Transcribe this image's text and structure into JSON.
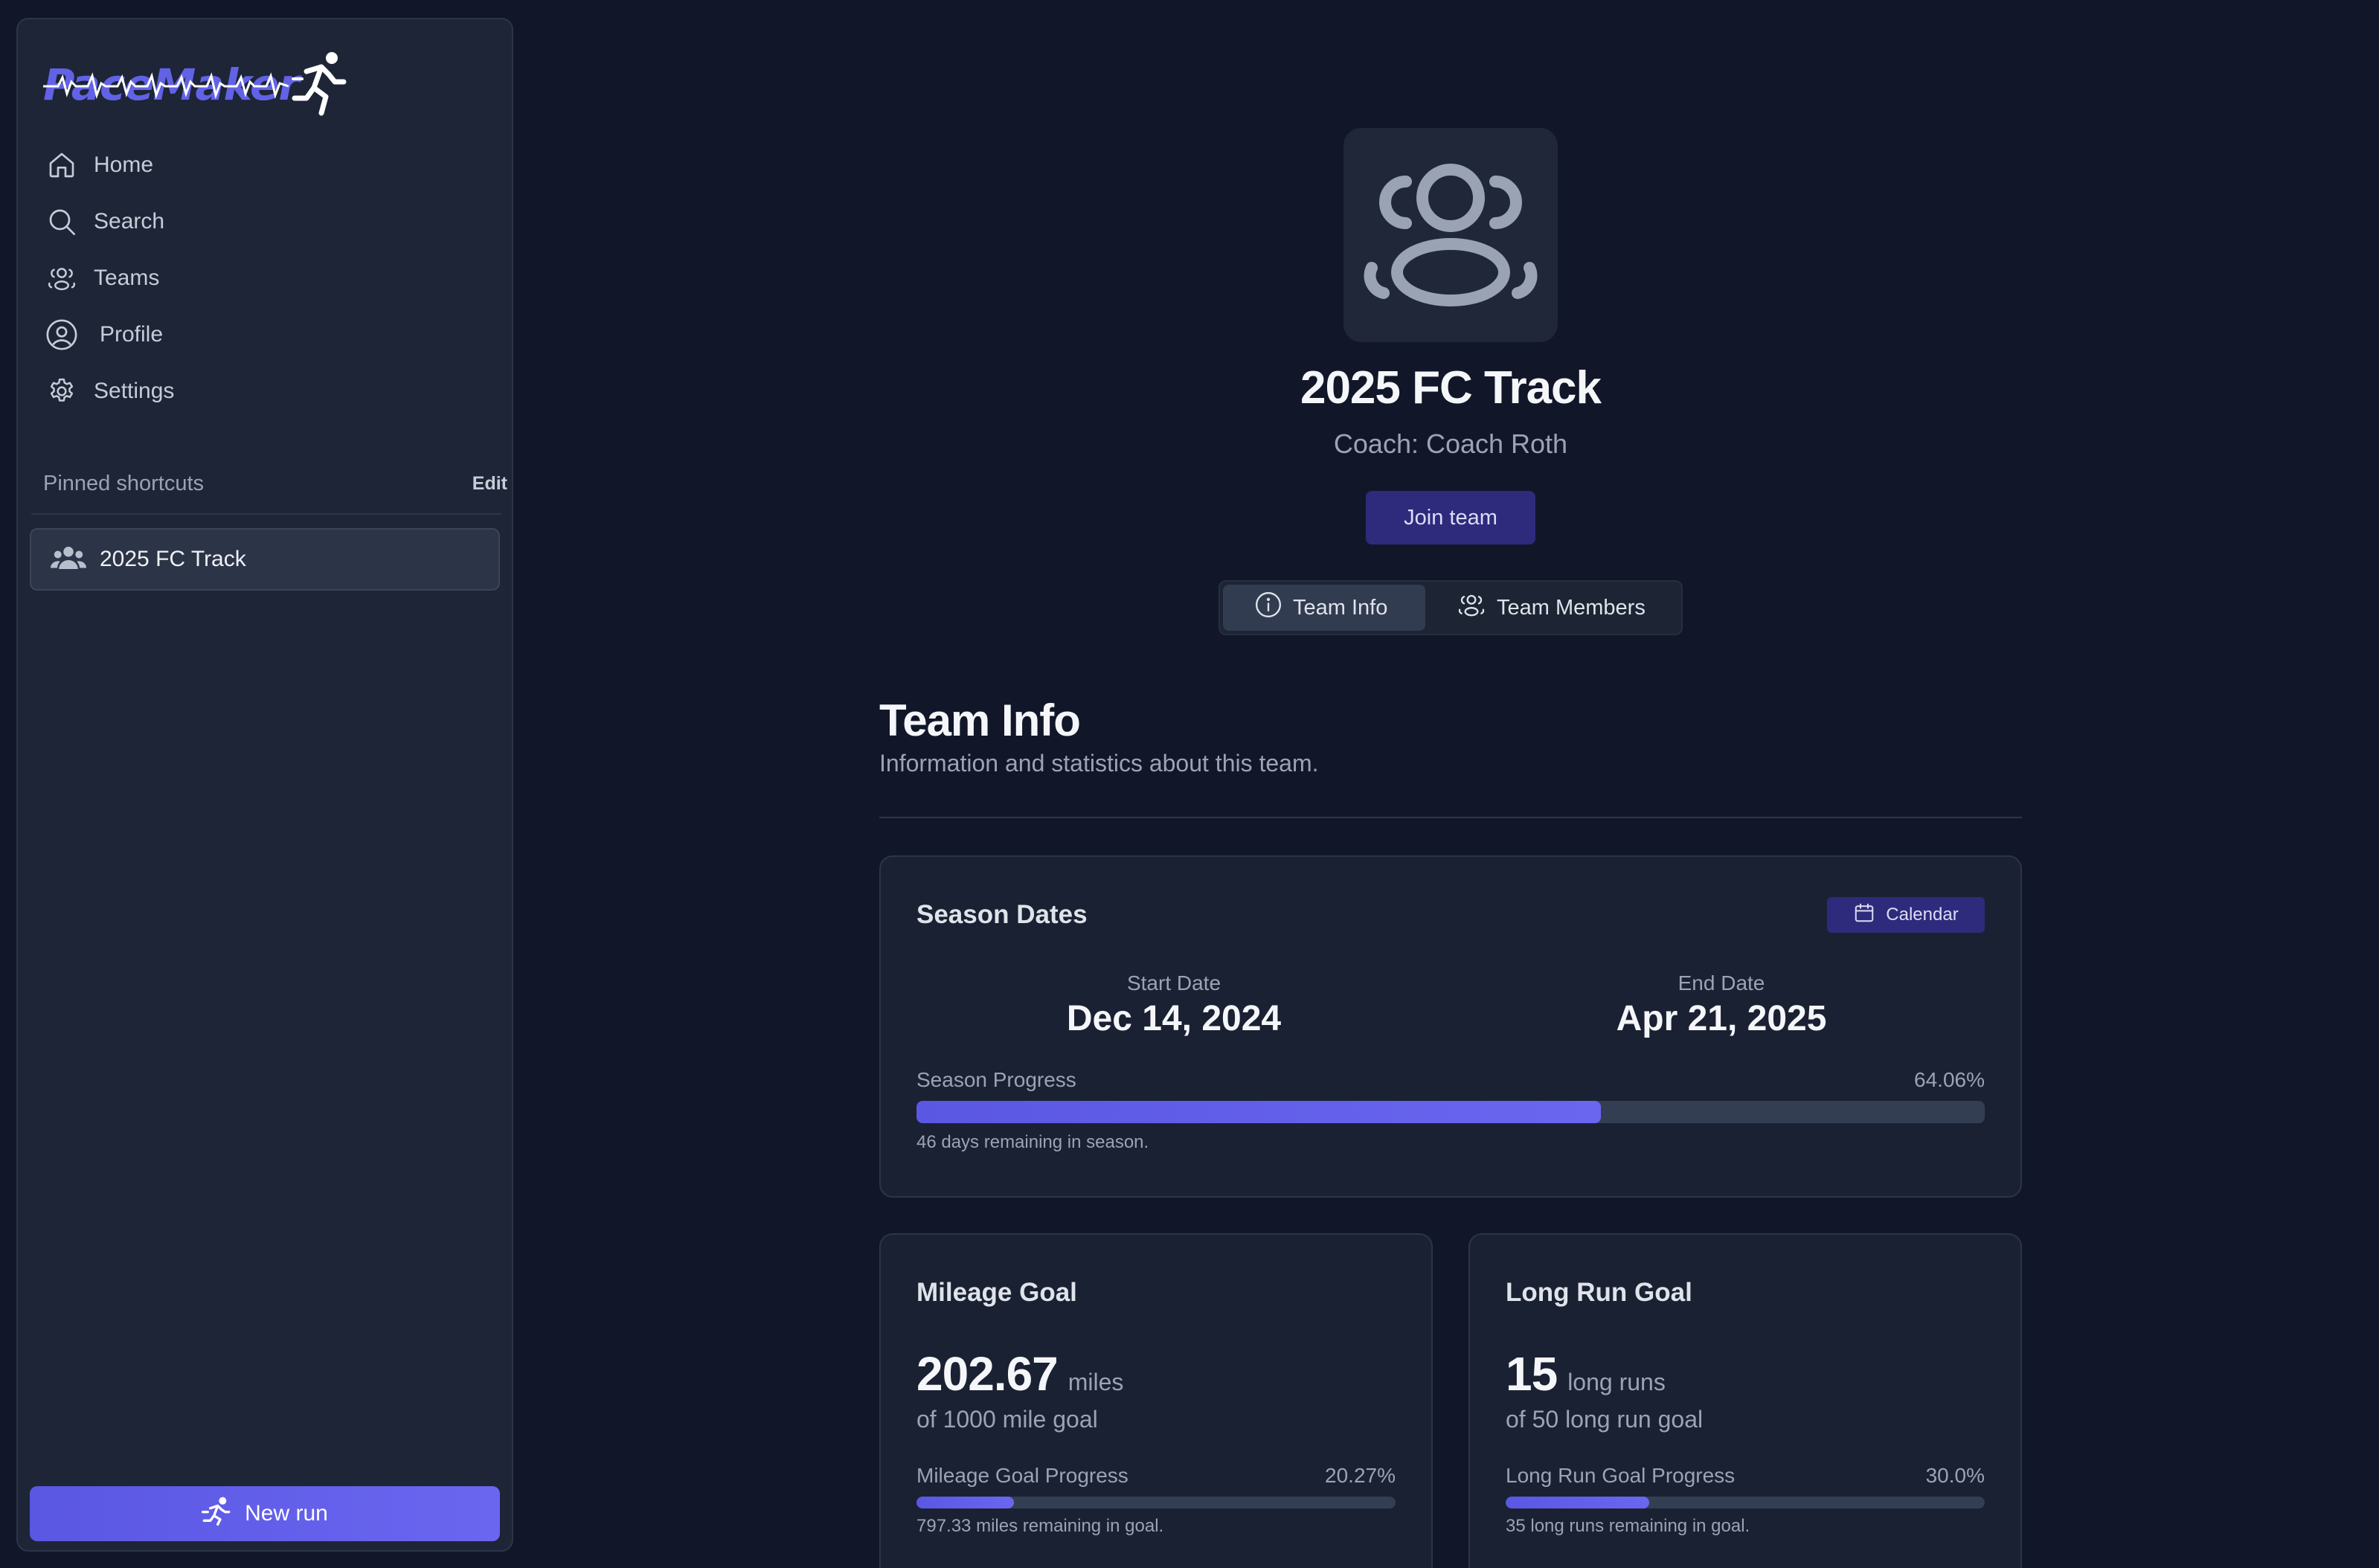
{
  "app": {
    "name": "PaceMaker",
    "accent": "#6262e6"
  },
  "sidebar": {
    "items": [
      {
        "label": "Home",
        "icon": "home-icon"
      },
      {
        "label": "Search",
        "icon": "search-icon"
      },
      {
        "label": "Teams",
        "icon": "users-icon"
      },
      {
        "label": "Profile",
        "icon": "user-circle-icon"
      },
      {
        "label": "Settings",
        "icon": "gear-icon"
      }
    ],
    "pinned_title": "Pinned shortcuts",
    "pinned_edit": "Edit",
    "pinned": [
      {
        "label": "2025 FC Track",
        "icon": "team-icon"
      }
    ],
    "new_run": "New run"
  },
  "team": {
    "name": "2025 FC Track",
    "coach": "Coach: Coach Roth",
    "join": "Join team",
    "tabs": [
      {
        "label": "Team Info",
        "active": true
      },
      {
        "label": "Team Members",
        "active": false
      }
    ]
  },
  "section": {
    "title": "Team Info",
    "subtitle": "Information and statistics about this team."
  },
  "season": {
    "title": "Season Dates",
    "calendar": "Calendar",
    "start_label": "Start Date",
    "start": "Dec 14, 2024",
    "end_label": "End Date",
    "end": "Apr 21, 2025",
    "progress_label": "Season Progress",
    "progress_text": "64.06%",
    "progress": 0.6406,
    "note": "46 days remaining in season."
  },
  "mileage": {
    "title": "Mileage Goal",
    "value": "202.67",
    "unit": "miles",
    "of": "of 1000 mile goal",
    "progress_label": "Mileage Goal Progress",
    "progress_text": "20.27%",
    "progress": 0.2027,
    "note": "797.33 miles remaining in goal."
  },
  "longrun": {
    "title": "Long Run Goal",
    "value": "15",
    "unit": "long runs",
    "of": "of 50 long run goal",
    "progress_label": "Long Run Goal Progress",
    "progress_text": "30.0%",
    "progress": 0.3,
    "note": "35 long runs remaining in goal."
  }
}
